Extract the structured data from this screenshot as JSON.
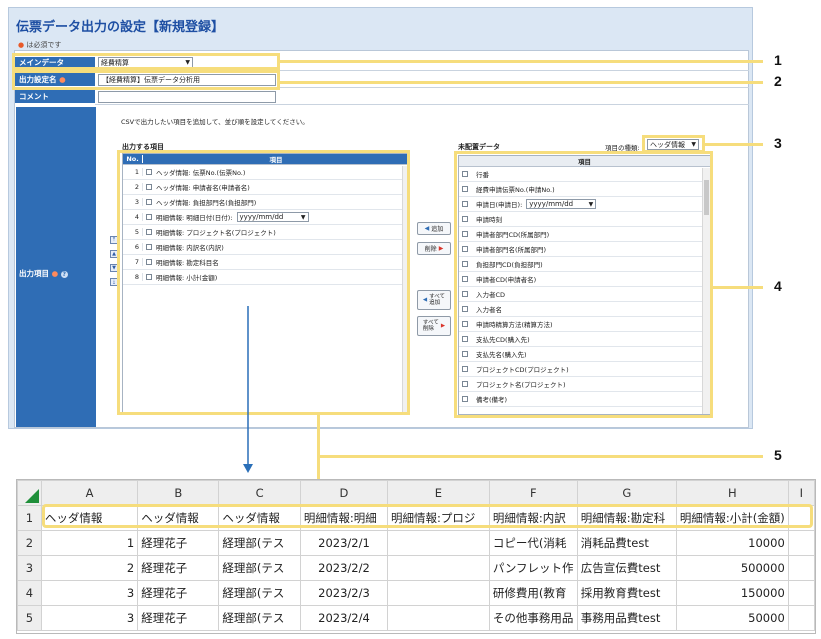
{
  "page": {
    "title": "伝票データ出力の設定【新規登録】",
    "required_note": "は必須です"
  },
  "form": {
    "main_data_label": "メインデータ",
    "main_data_value": "経費精算",
    "output_name_label": "出力設定名",
    "output_name_value": "【経費精算】伝票データ分析用",
    "comment_label": "コメント",
    "comment_value": "",
    "output_items_label": "出力項目",
    "instruction": "CSVで出力したい項目を追加して、並び順を設定してください。"
  },
  "left_list": {
    "title": "出力する項目",
    "col_no": "No.",
    "col_item": "項目",
    "rows": [
      {
        "no": "1",
        "text": "ヘッダ情報: 伝票No.(伝票No.)"
      },
      {
        "no": "2",
        "text": "ヘッダ情報: 申請者名(申請者名)"
      },
      {
        "no": "3",
        "text": "ヘッダ情報: 負担部門名(負担部門)"
      },
      {
        "no": "4",
        "text": "明細情報: 明細日付(日付):",
        "select": "yyyy/mm/dd"
      },
      {
        "no": "5",
        "text": "明細情報: プロジェクト名(プロジェクト)"
      },
      {
        "no": "6",
        "text": "明細情報: 内訳名(内訳)"
      },
      {
        "no": "7",
        "text": "明細情報: 勘定科目名"
      },
      {
        "no": "8",
        "text": "明細情報: 小計(金額)"
      }
    ]
  },
  "buttons": {
    "add": "追加",
    "remove": "削除",
    "add_all_1": "すべて",
    "add_all_2": "追加",
    "remove_all_1": "すべて",
    "remove_all_2": "削除"
  },
  "right_list": {
    "title": "未配置データ",
    "type_label": "項目の種類:",
    "type_value": "ヘッダ情報",
    "col_item": "項目",
    "rows": [
      {
        "text": "行番"
      },
      {
        "text": "経費申請伝票No.(申請No.)"
      },
      {
        "text": "申請日(申請日):",
        "select": "yyyy/mm/dd"
      },
      {
        "text": "申請時刻"
      },
      {
        "text": "申請者部門CD(所属部門)"
      },
      {
        "text": "申請者部門名(所属部門)"
      },
      {
        "text": "負担部門CD(負担部門)"
      },
      {
        "text": "申請者CD(申請者名)"
      },
      {
        "text": "入力者CD"
      },
      {
        "text": "入力者名"
      },
      {
        "text": "申請時精算方法(精算方法)"
      },
      {
        "text": "支払先CD(購入先)"
      },
      {
        "text": "支払先名(購入先)"
      },
      {
        "text": "プロジェクトCD(プロジェクト)"
      },
      {
        "text": "プロジェクト名(プロジェクト)"
      },
      {
        "text": "備考(備考)"
      }
    ]
  },
  "callouts": [
    "1",
    "2",
    "3",
    "4",
    "5"
  ],
  "sheet": {
    "columns": [
      "A",
      "B",
      "C",
      "D",
      "E",
      "F",
      "G",
      "H",
      "I"
    ],
    "row_numbers": [
      "1",
      "2",
      "3",
      "4",
      "5"
    ],
    "header": [
      "ヘッダ情報",
      "ヘッダ情報",
      "ヘッダ情報",
      "明細情報:明細",
      "明細情報:プロジ",
      "明細情報:内訳",
      "明細情報:勘定科",
      "明細情報:小計(金額)",
      ""
    ],
    "rows": [
      [
        "1",
        "経理花子",
        "経理部(テス",
        "2023/2/1",
        "",
        "コピー代(消耗",
        "消耗品費test",
        "10000",
        ""
      ],
      [
        "2",
        "経理花子",
        "経理部(テス",
        "2023/2/2",
        "",
        "パンフレット作",
        "広告宣伝費test",
        "500000",
        ""
      ],
      [
        "3",
        "経理花子",
        "経理部(テス",
        "2023/2/3",
        "",
        "研修費用(教育",
        "採用教育費test",
        "150000",
        ""
      ],
      [
        "3",
        "経理花子",
        "経理部(テス",
        "2023/2/4",
        "",
        "その他事務用品",
        "事務用品費test",
        "50000",
        ""
      ]
    ]
  },
  "colors": {
    "accent": "#2f6db5",
    "highlight": "#f6dd7c",
    "arrow": "#2a6fb8"
  }
}
